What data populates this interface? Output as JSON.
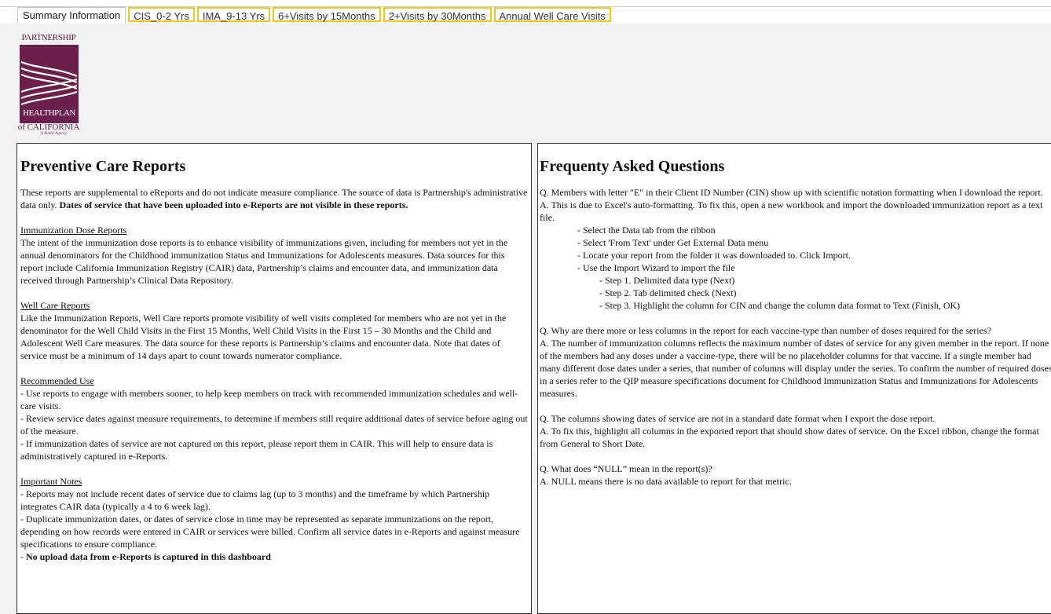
{
  "tabs": [
    {
      "label": "Summary Information",
      "active": true
    },
    {
      "label": "CIS_0-2 Yrs",
      "active": false
    },
    {
      "label": "IMA_9-13 Yrs",
      "active": false
    },
    {
      "label": "6+Visits by 15Months",
      "active": false
    },
    {
      "label": "2+Visits by 30Months",
      "active": false
    },
    {
      "label": "Annual Well Care Visits",
      "active": false
    }
  ],
  "logo": {
    "line1": "PARTNERSHIP",
    "line2": "HEALTHPLAN",
    "line3": "of CALIFORNIA",
    "tagline": "A Public Agency"
  },
  "left": {
    "title": "Preventive Care Reports",
    "intro": "These reports are supplemental to eReports and do not indicate measure compliance. The source of data is Partnership's administrative data only. ",
    "intro_bold": "Dates of service that have been uploaded into e-Reports are not visible in these reports.",
    "imm_heading": "Immunization Dose Reports",
    "imm_text": "The intent of the immunization dose reports is to enhance visibility of immunizations given, including for members not yet in the annual denominators for the Childhood immunization Status and Immunizations for Adolescents measures. Data sources for this report include California Immunization Registry (CAIR) data, Partnership’s claims and encounter data, and immunization data received through Partnership’s Clinical Data Repository.",
    "well_heading": "Well Care Reports",
    "well_text": "Like the Immunization Reports, Well Care reports promote visibility of well visits completed for members who are not yet in the denominator for the Well Child Visits in the First 15 Months, Well Child Visits in the First 15 – 30 Months and the Child and Adolescent Well Care measures. The data source for these reports is Partnership’s claims and encounter data. Note that dates of service must be a minimum of 14 days apart to count towards numerator compliance.",
    "rec_heading": "Recommended Use",
    "rec_items": [
      "- Use reports to engage with members sooner, to help keep members on track with recommended immunization schedules and well-care visits.",
      "- Review service dates against measure requirements, to determine if members still require additional dates of service before aging out of the measure.",
      "- If immunization dates of service are not captured on this report, please report them in CAIR. This will help to ensure data is administratively captured in e-Reports."
    ],
    "notes_heading": "Important Notes",
    "notes_items": [
      "- Reports may not include recent dates of service due to claims lag (up to 3 months) and the timeframe by which Partnership integrates CAIR data (typically a 4 to 6 week lag).",
      "- Duplicate immunization dates, or dates of service close in time may be represented as separate immunizations on the report, depending on how records were entered in CAIR or services were billed. Confirm all service dates in e-Reports and against measure specifications to ensure compliance."
    ],
    "notes_last_prefix": "- ",
    "notes_last_bold": "No upload data from e-Reports is captured in this dashboard"
  },
  "right": {
    "title": "Frequenty Asked Questions",
    "q1": "Q. Members with letter \"E\" in their Client ID Number (CIN) show up with scientific notation formatting when I download the report.",
    "a1": "A. This is due to Excel's auto-formatting. To fix this, open a new workbook and import the downloaded immunization report as a text file.",
    "steps": [
      "- Select the Data tab from the ribbon",
      "- Select 'From Text' under Get External Data menu",
      "- Locate your report from the folder it was downloaded to. Click Import.",
      "- Use the Import Wizard to import the file"
    ],
    "substeps": [
      "- Step 1. Delimited data type (Next)",
      "- Step 2. Tab delimited check (Next)",
      "- Step 3. Highlight the column for CIN and change the column data format to Text (Finish, OK)"
    ],
    "q2": "Q. Why are there more or less columns in the report for each vaccine-type than number of doses required for the series?",
    "a2": "A.  The number of immunization columns reflects the maximum number of dates of service for any given member in the report. If none of the members had any doses under a vaccine-type, there will be no placeholder columns for that vaccine. If a single member had many different dose dates under a series, that number of columns will display under the series. To confirm the number of required doses in a series refer to the QIP measure specifications document for Childhood Immunization Status and Immunizations for Adolescents measures.",
    "q3": "Q. The columns showing dates of service are not in a standard date format when I export the dose report.",
    "a3": "A. To fix this, highlight all columns in the exported report that should show dates of service. On the Excel ribbon, change the format from General to Short Date.",
    "q4": "Q. What does “NULL” mean in the report(s)?",
    "a4": "A. NULL means there is no data available to report for that metric."
  },
  "colors": {
    "tab_highlight": "#f5c518",
    "logo_purple": "#6b1f4b"
  }
}
